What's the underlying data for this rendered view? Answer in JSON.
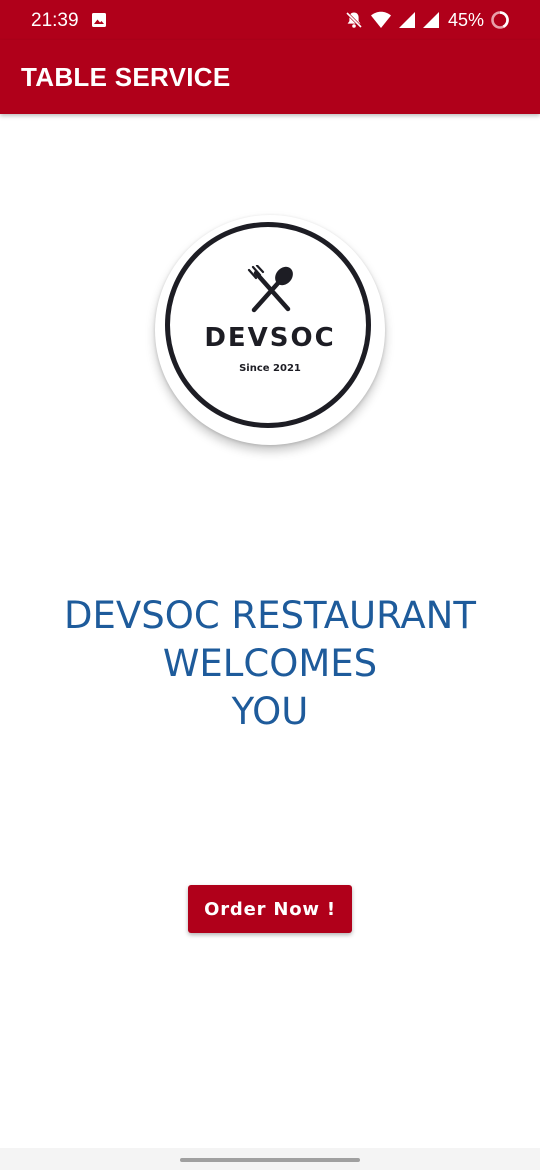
{
  "status_bar": {
    "time": "21:39",
    "battery": "45%",
    "icons": [
      "gallery-icon",
      "bell-muted-icon",
      "wifi-icon",
      "signal-icon",
      "signal-icon",
      "battery-ring-icon"
    ],
    "background": "#b0001a"
  },
  "app_bar": {
    "title": "TABLE SERVICE",
    "background": "#b0001a"
  },
  "logo": {
    "icon": "fork-spoon-icon",
    "name": "DEVSOC",
    "since": "Since 2021"
  },
  "welcome": {
    "line1": "DEVSOC RESTAURANT",
    "line2": "WELCOMES",
    "line3": "YOU",
    "color": "#1e5b9b"
  },
  "order_button": {
    "label": "Order Now !",
    "color": "#b0001a"
  }
}
